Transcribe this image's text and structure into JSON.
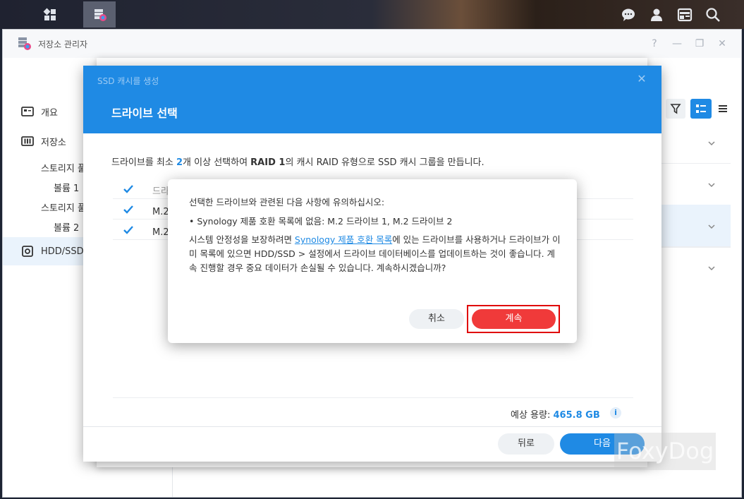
{
  "taskbar": {
    "icons": [
      "main-menu-icon",
      "storage-manager-icon",
      "chat-icon",
      "user-icon",
      "widgets-icon",
      "search-icon"
    ]
  },
  "window": {
    "title": "저장소 관리자",
    "controls": [
      "?",
      "—",
      "❐",
      "✕"
    ]
  },
  "sidebar": {
    "items": [
      {
        "label": "개요",
        "icon": "overview-icon"
      },
      {
        "label": "저장소",
        "icon": "storage-icon"
      },
      {
        "label": "HDD/SSD",
        "icon": "hdd-icon"
      }
    ],
    "sub_items": [
      "스토리지 풀",
      "볼륨 1",
      "스토리지 풀",
      "볼륨 2"
    ]
  },
  "wizard": {
    "title_small": "SSD 캐시를 생성",
    "step_title": "드라이브 선택",
    "description_pre": "드라이브를 최소 ",
    "description_count": "2",
    "description_mid": "개 이상 선택하여 ",
    "description_raid": "RAID 1",
    "description_post": "의 캐시 RAID 유형으로 SSD 캐시 그룹을 만듭니다.",
    "table_header": "드라이브",
    "drives": [
      "M.2 드라이브 1",
      "M.2 드라이브 2"
    ],
    "capacity_label": "예상 용량:",
    "capacity_value": "465.8 GB",
    "back_label": "뒤로",
    "next_label": "다음"
  },
  "alert": {
    "line1": "선택한 드라이브와 관련된 다음 사항에 유의하십시오:",
    "bullet": "• Synology 제품 호환 목록에 없음: M.2 드라이브 1, M.2 드라이브 2",
    "para_pre": "시스템 안정성을 보장하려면 ",
    "para_link": "Synology 제품 호환 목록",
    "para_post": "에 있는 드라이브를 사용하거나 드라이브가 이미 목록에 있으면 HDD/SSD > 설정에서 드라이브 데이터베이스를 업데이트하는 것이 좋습니다. 계속 진행할 경우 중요 데이터가 손실될 수 있습니다. 계속하시겠습니까?",
    "cancel_label": "취소",
    "continue_label": "계속"
  },
  "watermark": "FoxyDog",
  "colors": {
    "accent": "#1f8ae4",
    "danger": "#f03a3a",
    "highlight_frame": "#e00000"
  }
}
